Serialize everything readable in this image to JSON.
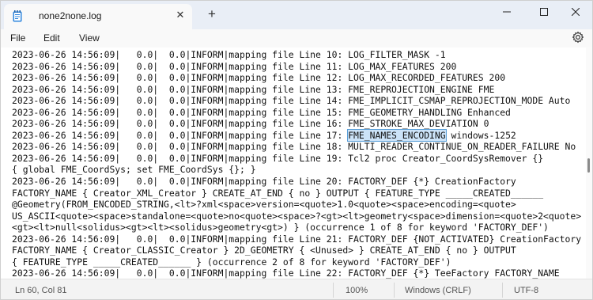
{
  "tab": {
    "icon": "notepad-icon",
    "title": "none2none.log",
    "close_icon": "close-icon"
  },
  "new_tab_icon": "plus-icon",
  "window_controls": [
    "minimize-icon",
    "maximize-icon",
    "close-icon"
  ],
  "menu": {
    "file": "File",
    "edit": "Edit",
    "view": "View",
    "settings_icon": "gear-icon"
  },
  "editor": {
    "highlight_color": "#cce3f8",
    "lines": [
      "2023-06-26 14:56:09|   0.0|  0.0|INFORM|mapping file Line 10: LOG_FILTER_MASK -1",
      "2023-06-26 14:56:09|   0.0|  0.0|INFORM|mapping file Line 11: LOG_MAX_FEATURES 200",
      "2023-06-26 14:56:09|   0.0|  0.0|INFORM|mapping file Line 12: LOG_MAX_RECORDED_FEATURES 200",
      "2023-06-26 14:56:09|   0.0|  0.0|INFORM|mapping file Line 13: FME_REPROJECTION_ENGINE FME",
      "2023-06-26 14:56:09|   0.0|  0.0|INFORM|mapping file Line 14: FME_IMPLICIT_CSMAP_REPROJECTION_MODE Auto",
      "2023-06-26 14:56:09|   0.0|  0.0|INFORM|mapping file Line 15: FME_GEOMETRY_HANDLING Enhanced",
      "2023-06-26 14:56:09|   0.0|  0.0|INFORM|mapping file Line 16: FME_STROKE_MAX_DEVIATION 0",
      "2023-06-26 14:56:09|   0.0|  0.0|INFORM|mapping file Line 17: ",
      "2023-06-26 14:56:09|   0.0|  0.0|INFORM|mapping file Line 18: MULTI_READER_CONTINUE_ON_READER_FAILURE No",
      "2023-06-26 14:56:09|   0.0|  0.0|INFORM|mapping file Line 19: Tcl2 proc Creator_CoordSysRemover {}",
      "{ global FME_CoordSys; set FME_CoordSys {}; }",
      "2023-06-26 14:56:09|   0.0|  0.0|INFORM|mapping file Line 20: FACTORY_DEF {*} CreationFactory",
      "FACTORY_NAME { Creator_XML_Creator } CREATE_AT_END { no } OUTPUT { FEATURE_TYPE _____CREATED______",
      "@Geometry(FROM_ENCODED_STRING,<lt>?xml<space>version=<quote>1.0<quote><space>encoding=<quote>",
      "US_ASCII<quote><space>standalone=<quote>no<quote><space>?<gt><lt>geometry<space>dimension=<quote>2<quote>",
      "<gt><lt>null<solidus><gt><lt><solidus>geometry<gt>) } (occurrence 1 of 8 for keyword 'FACTORY_DEF')",
      "2023-06-26 14:56:09|   0.0|  0.0|INFORM|mapping file Line 21: FACTORY_DEF {NOT_ACTIVATED} CreationFactory",
      "FACTORY_NAME { Creator_CLASSIC_Creator } 2D_GEOMETRY { <Unused> } CREATE_AT_END { no } OUTPUT",
      "{ FEATURE_TYPE _____CREATED______ } (occurrence 2 of 8 for keyword 'FACTORY_DEF')",
      "2023-06-26 14:56:09|   0.0|  0.0|INFORM|mapping file Line 22: FACTORY_DEF {*} TeeFactory FACTORY_NAME"
    ],
    "selection_text": "FME_NAMES_ENCODING",
    "selection_suffix": " windows-1252"
  },
  "status": {
    "position": "Ln 60, Col 81",
    "zoom": "100%",
    "line_ending": "Windows (CRLF)",
    "encoding": "UTF-8"
  }
}
